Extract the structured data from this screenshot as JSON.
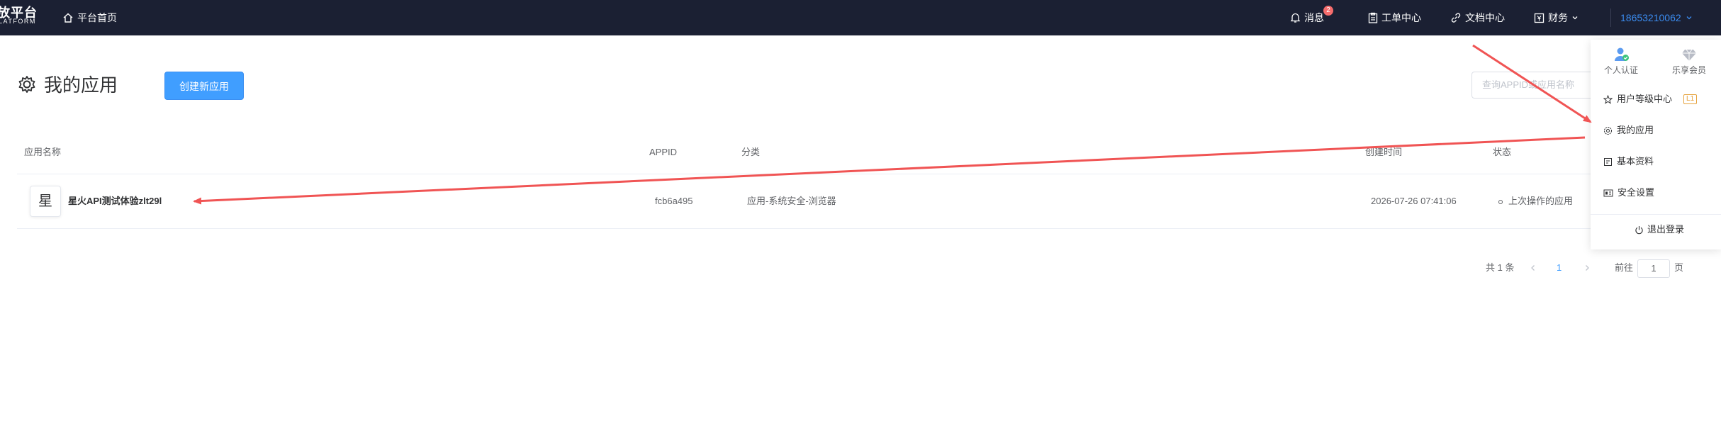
{
  "header": {
    "logo_main": "放平台",
    "logo_sub": "LATFORM",
    "home": "平台首页",
    "messages": "消息",
    "message_count": "2",
    "tickets": "工单中心",
    "docs": "文档中心",
    "finance": "财务",
    "user_phone": "18653210062"
  },
  "page": {
    "title": "我的应用",
    "create_button": "创建新应用",
    "search_placeholder": "查询APPID或应用名称"
  },
  "table": {
    "headers": {
      "name": "应用名称",
      "appid": "APPID",
      "category": "分类",
      "created": "创建时间",
      "status": "状态"
    },
    "rows": [
      {
        "logo_char": "星",
        "name": "星火API测试体验zlt29l",
        "appid": "fcb6a495",
        "category": "应用-系统安全-浏览器",
        "created": "2026-07-26 07:41:06",
        "status": "上次操作的应用"
      }
    ]
  },
  "pagination": {
    "total": "共 1 条",
    "current_page": "1",
    "goto_label": "前往",
    "goto_value": "1",
    "page_suffix": "页"
  },
  "user_menu": {
    "verify": "个人认证",
    "membership": "乐享会员",
    "level_center": "用户等级中心",
    "level_badge": "L1",
    "my_apps": "我的应用",
    "profile": "基本资料",
    "security": "安全设置",
    "logout": "退出登录"
  },
  "colors": {
    "topbar": "#1b2033",
    "primary": "#409eff",
    "annotation_arrow": "#f05454"
  }
}
